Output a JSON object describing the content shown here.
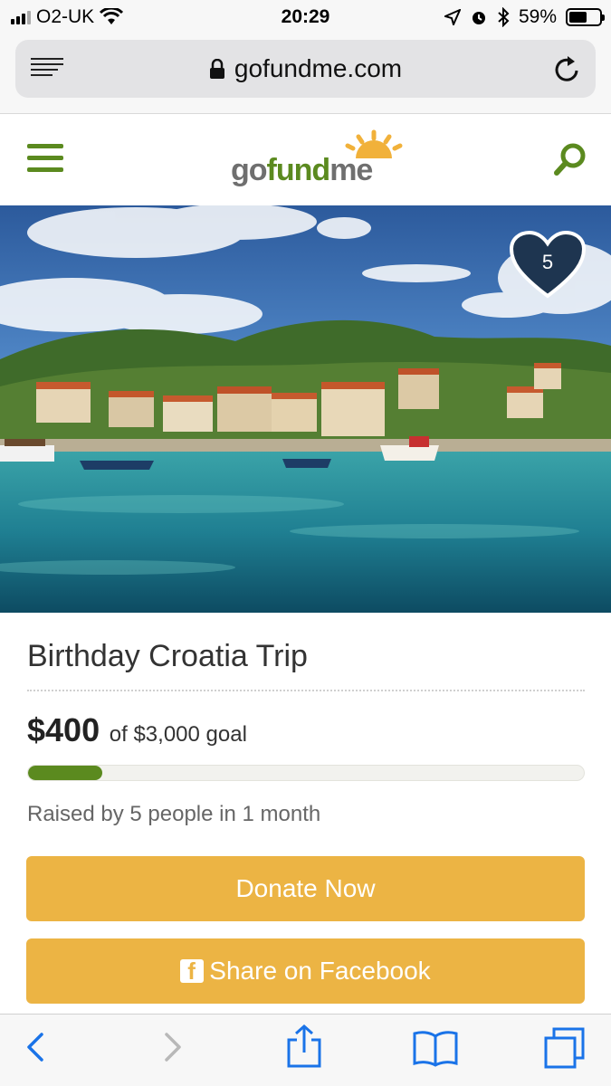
{
  "status_bar": {
    "carrier": "O2-UK",
    "time": "20:29",
    "battery_percent": "59%",
    "battery_level": 0.59
  },
  "browser": {
    "url": "gofundme.com"
  },
  "site": {
    "logo": "gofundme",
    "accent_color": "#5b8a1f",
    "button_color": "#ecb444"
  },
  "hero": {
    "favorites_count": "5"
  },
  "campaign": {
    "title": "Birthday Croatia Trip",
    "raised": "$400",
    "goal_text": "of $3,000 goal",
    "progress_fraction": 0.1333,
    "raised_by": "Raised by 5 people in 1 month"
  },
  "actions": {
    "donate_label": "Donate Now",
    "share_label": "Share on Facebook"
  }
}
